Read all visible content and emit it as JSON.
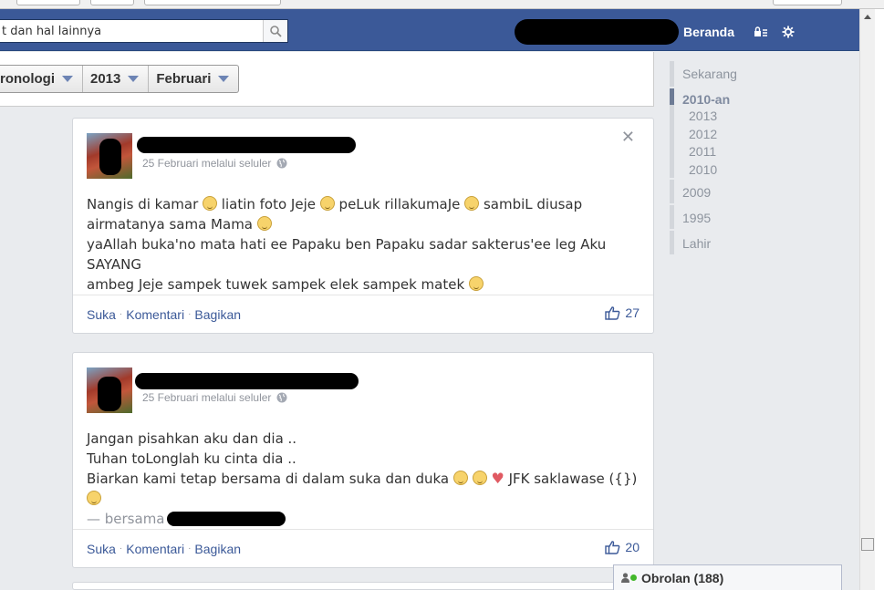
{
  "topbar": {
    "search_placeholder": "t dan hal lainnya",
    "home_label": "Beranda",
    "color": "#3b5998"
  },
  "timeline": {
    "filters": [
      "ronologi",
      "2013",
      "Februari"
    ]
  },
  "posts": [
    {
      "meta": "25 Februari melalui seluler",
      "lines": [
        "Nangis di kamar",
        "liatin foto Jeje",
        "peLuk rillakumaJe",
        "sambiL diusap",
        "airmatanya sama Mama",
        "yaAllah buka'no mata hati ee Papaku ben Papaku sadar sakterus'ee leg Aku SAYANG",
        "ambeg Jeje sampek tuwek sampek elek sampek matek"
      ],
      "actions": {
        "like": "Suka",
        "comment": "Komentari",
        "share": "Bagikan"
      },
      "like_count": "27"
    },
    {
      "meta": "25 Februari melalui seluler",
      "lines": [
        "Jangan pisahkan aku dan dia ..",
        "Tuhan toLonglah ku cinta dia ..",
        "Biarkan kami tetap bersama di dalam suka dan duka",
        "JFK saklawase ({})",
        "— bersama"
      ],
      "actions": {
        "like": "Suka",
        "comment": "Komentari",
        "share": "Bagikan"
      },
      "like_count": "20"
    }
  ],
  "scrubber": {
    "now": "Sekarang",
    "decade": "2010-an",
    "years": [
      "2013",
      "2012",
      "2011",
      "2010"
    ],
    "y2009": "2009",
    "y1995": "1995",
    "born": "Lahir"
  },
  "chat": {
    "label": "Obrolan (188)"
  }
}
